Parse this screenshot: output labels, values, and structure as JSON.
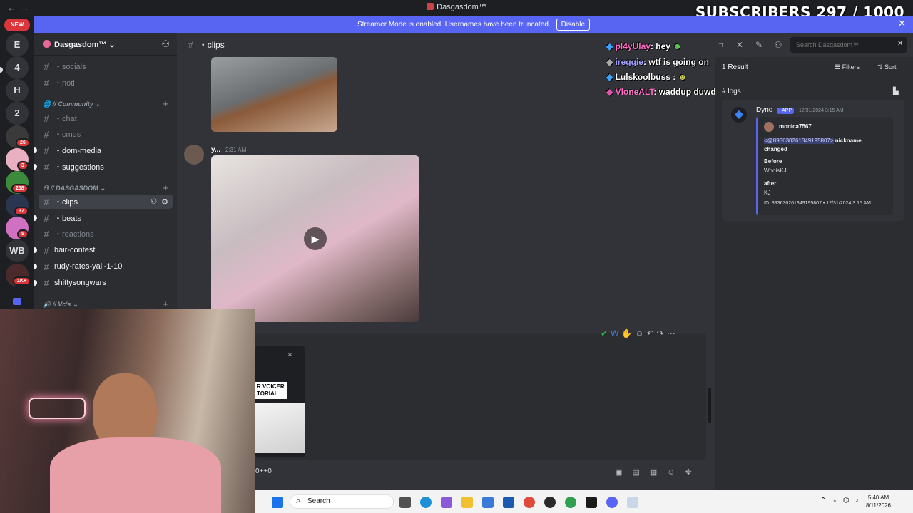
{
  "app": {
    "title": "Dasgasdom™",
    "back": "←",
    "forward": "→"
  },
  "overlay": {
    "subscribers": "SUBSCRIBERS 297 / 1000"
  },
  "banner": {
    "text": "Streamer Mode is enabled. Usernames have been truncated.",
    "button": "Disable",
    "close": "✕"
  },
  "rail": {
    "new_label": "NEW",
    "items": [
      {
        "label": "E"
      },
      {
        "label": "4"
      },
      {
        "label": "H"
      },
      {
        "label": "2"
      },
      {
        "label": "",
        "badge": "26"
      },
      {
        "label": "",
        "badge": "3"
      },
      {
        "label": "",
        "badge": "258"
      },
      {
        "label": "",
        "badge": "37"
      },
      {
        "label": "",
        "badge": "5"
      },
      {
        "label": "WB"
      },
      {
        "label": "",
        "badge": "1K+"
      }
    ]
  },
  "sidebar": {
    "server_name": "Dasgasdom™",
    "channels_top": [
      "・socials",
      "・noti"
    ],
    "cat_community": "// Community",
    "community": [
      "・chat",
      "・cmds",
      "・dom-media",
      "・suggestions"
    ],
    "cat_dasgasdom": "// DASGASDOM",
    "dasgasdom": [
      "・clips",
      "・beats",
      "・reactions",
      "hair-contest",
      "rudy-rates-yall-1-10",
      "shittysongwars"
    ],
    "cat_vcs": "// Vc's"
  },
  "header": {
    "channel": "・clips"
  },
  "search": {
    "placeholder": "Search Dasgasdom™"
  },
  "chat_overlay": [
    {
      "user": "pl4yUlay",
      "msg": ": hey",
      "color": "#ff6ec7"
    },
    {
      "user": "ireggie",
      "msg": ": wtf is going on",
      "color": "#a0a0ff"
    },
    {
      "user": "Lulskoolbuss",
      "msg": ":",
      "color": "#ffffff"
    },
    {
      "user": "VloneALT",
      "msg": ": waddup duwdee",
      "color": "#ff6ec7"
    }
  ],
  "message": {
    "author": "y...",
    "time": "2:31 AM"
  },
  "results": {
    "count": "1 Result",
    "filters": "Filters",
    "sort": "Sort",
    "channel": "logs",
    "bot_name": "Dyno",
    "bot_tag": "APP",
    "timestamp": "12/31/2024 3:15 AM",
    "embed_user": "monica7567",
    "mention": "<@893630261349195807>",
    "action": "nickname changed",
    "before_label": "Before",
    "before_value": "WhoisKJ",
    "after_label": "after",
    "after_value": "KJ",
    "footer": "ID: 893630261349195807 • 12/31/2024 3:15 AM"
  },
  "composer": {
    "text": "0++0",
    "video_caption": "R VOICER TORIAL"
  },
  "taskbar": {
    "search": "Search",
    "time": "5:40 AM",
    "date": "8/11/2026"
  }
}
